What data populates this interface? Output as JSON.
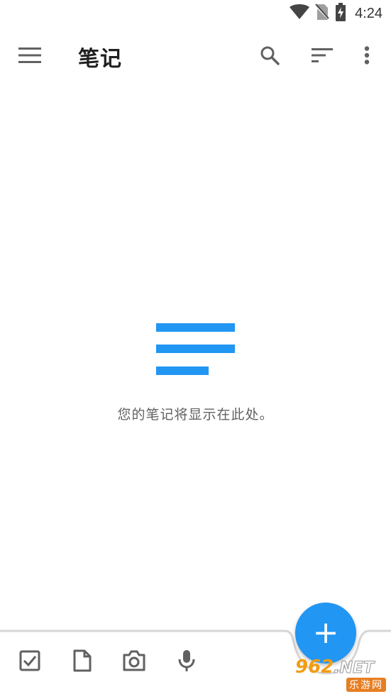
{
  "status_bar": {
    "time": "4:24",
    "icons": [
      "wifi-icon",
      "no-sim-icon",
      "battery-charging-icon"
    ]
  },
  "app_bar": {
    "title": "笔记",
    "icons": [
      "menu-icon",
      "search-icon",
      "sort-icon",
      "more-vert-icon"
    ]
  },
  "empty_state": {
    "icon": "notes-lines-icon",
    "message": "您的笔记将显示在此处。"
  },
  "bottom_bar": {
    "icons": [
      "checkbox-icon",
      "document-icon",
      "camera-icon",
      "microphone-icon"
    ]
  },
  "fab": {
    "icon": "plus-icon",
    "label": "+"
  },
  "watermark": {
    "top_text": "962",
    "suffix": ".NET",
    "bottom_text": "乐游网"
  },
  "colors": {
    "accent": "#2196f3",
    "icon_gray": "#616161",
    "text_secondary": "#616161"
  }
}
